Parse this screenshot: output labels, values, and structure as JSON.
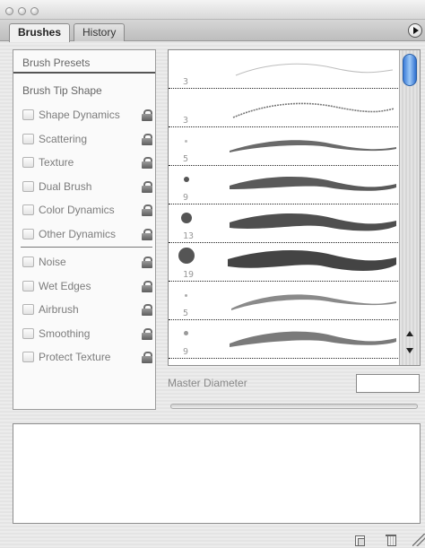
{
  "tabs": [
    {
      "label": "Brushes",
      "active": true
    },
    {
      "label": "History",
      "active": false
    }
  ],
  "options": {
    "brush_presets": "Brush Presets",
    "brush_tip_shape": "Brush Tip Shape",
    "group1": [
      {
        "label": "Shape Dynamics",
        "locked": true
      },
      {
        "label": "Scattering",
        "locked": true
      },
      {
        "label": "Texture",
        "locked": true
      },
      {
        "label": "Dual Brush",
        "locked": true
      },
      {
        "label": "Color Dynamics",
        "locked": true
      },
      {
        "label": "Other Dynamics",
        "locked": true
      }
    ],
    "group2": [
      {
        "label": "Noise",
        "locked": true
      },
      {
        "label": "Wet Edges",
        "locked": true
      },
      {
        "label": "Airbrush",
        "locked": true
      },
      {
        "label": "Smoothing",
        "locked": true
      },
      {
        "label": "Protect Texture",
        "locked": true
      }
    ]
  },
  "brushes": [
    {
      "size": "3"
    },
    {
      "size": "3"
    },
    {
      "size": "5"
    },
    {
      "size": "9"
    },
    {
      "size": "13"
    },
    {
      "size": "19"
    },
    {
      "size": "5"
    },
    {
      "size": "9"
    }
  ],
  "master_diameter": {
    "label": "Master Diameter",
    "value": ""
  },
  "icons": {
    "panel_menu": "triangle-right-icon",
    "new_brush": "new-brush-icon",
    "delete_brush": "trash-icon",
    "resize": "resize-grip-icon",
    "lock": "lock-icon"
  },
  "colors": {
    "scroll_thumb": "#3b7cd8",
    "stroke": "#555555"
  }
}
